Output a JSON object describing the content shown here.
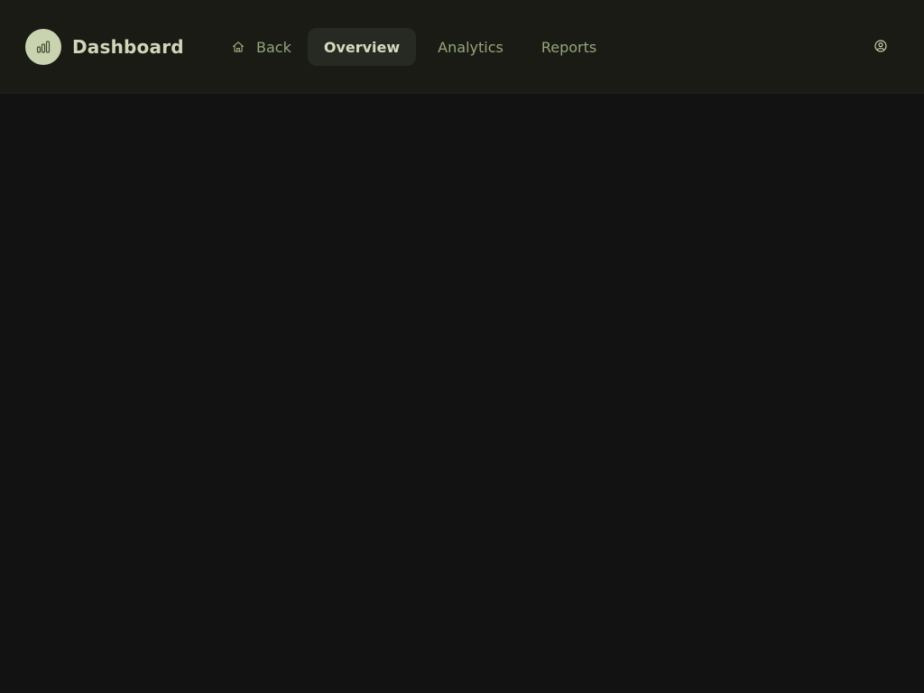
{
  "header": {
    "title": "Dashboard",
    "logo_icon": "bar-chart-icon",
    "account_icon": "user-circle-icon"
  },
  "nav": {
    "back_label": "Back",
    "back_icon": "home-icon",
    "tabs": [
      {
        "label": "Overview",
        "active": true
      },
      {
        "label": "Analytics",
        "active": false
      },
      {
        "label": "Reports",
        "active": false
      }
    ]
  },
  "colors": {
    "accent": "#c9d3b0",
    "nav_text": "#96a67a",
    "active_bg": "#272a23",
    "background": "#121212",
    "header_bg": "#1a1b15"
  }
}
